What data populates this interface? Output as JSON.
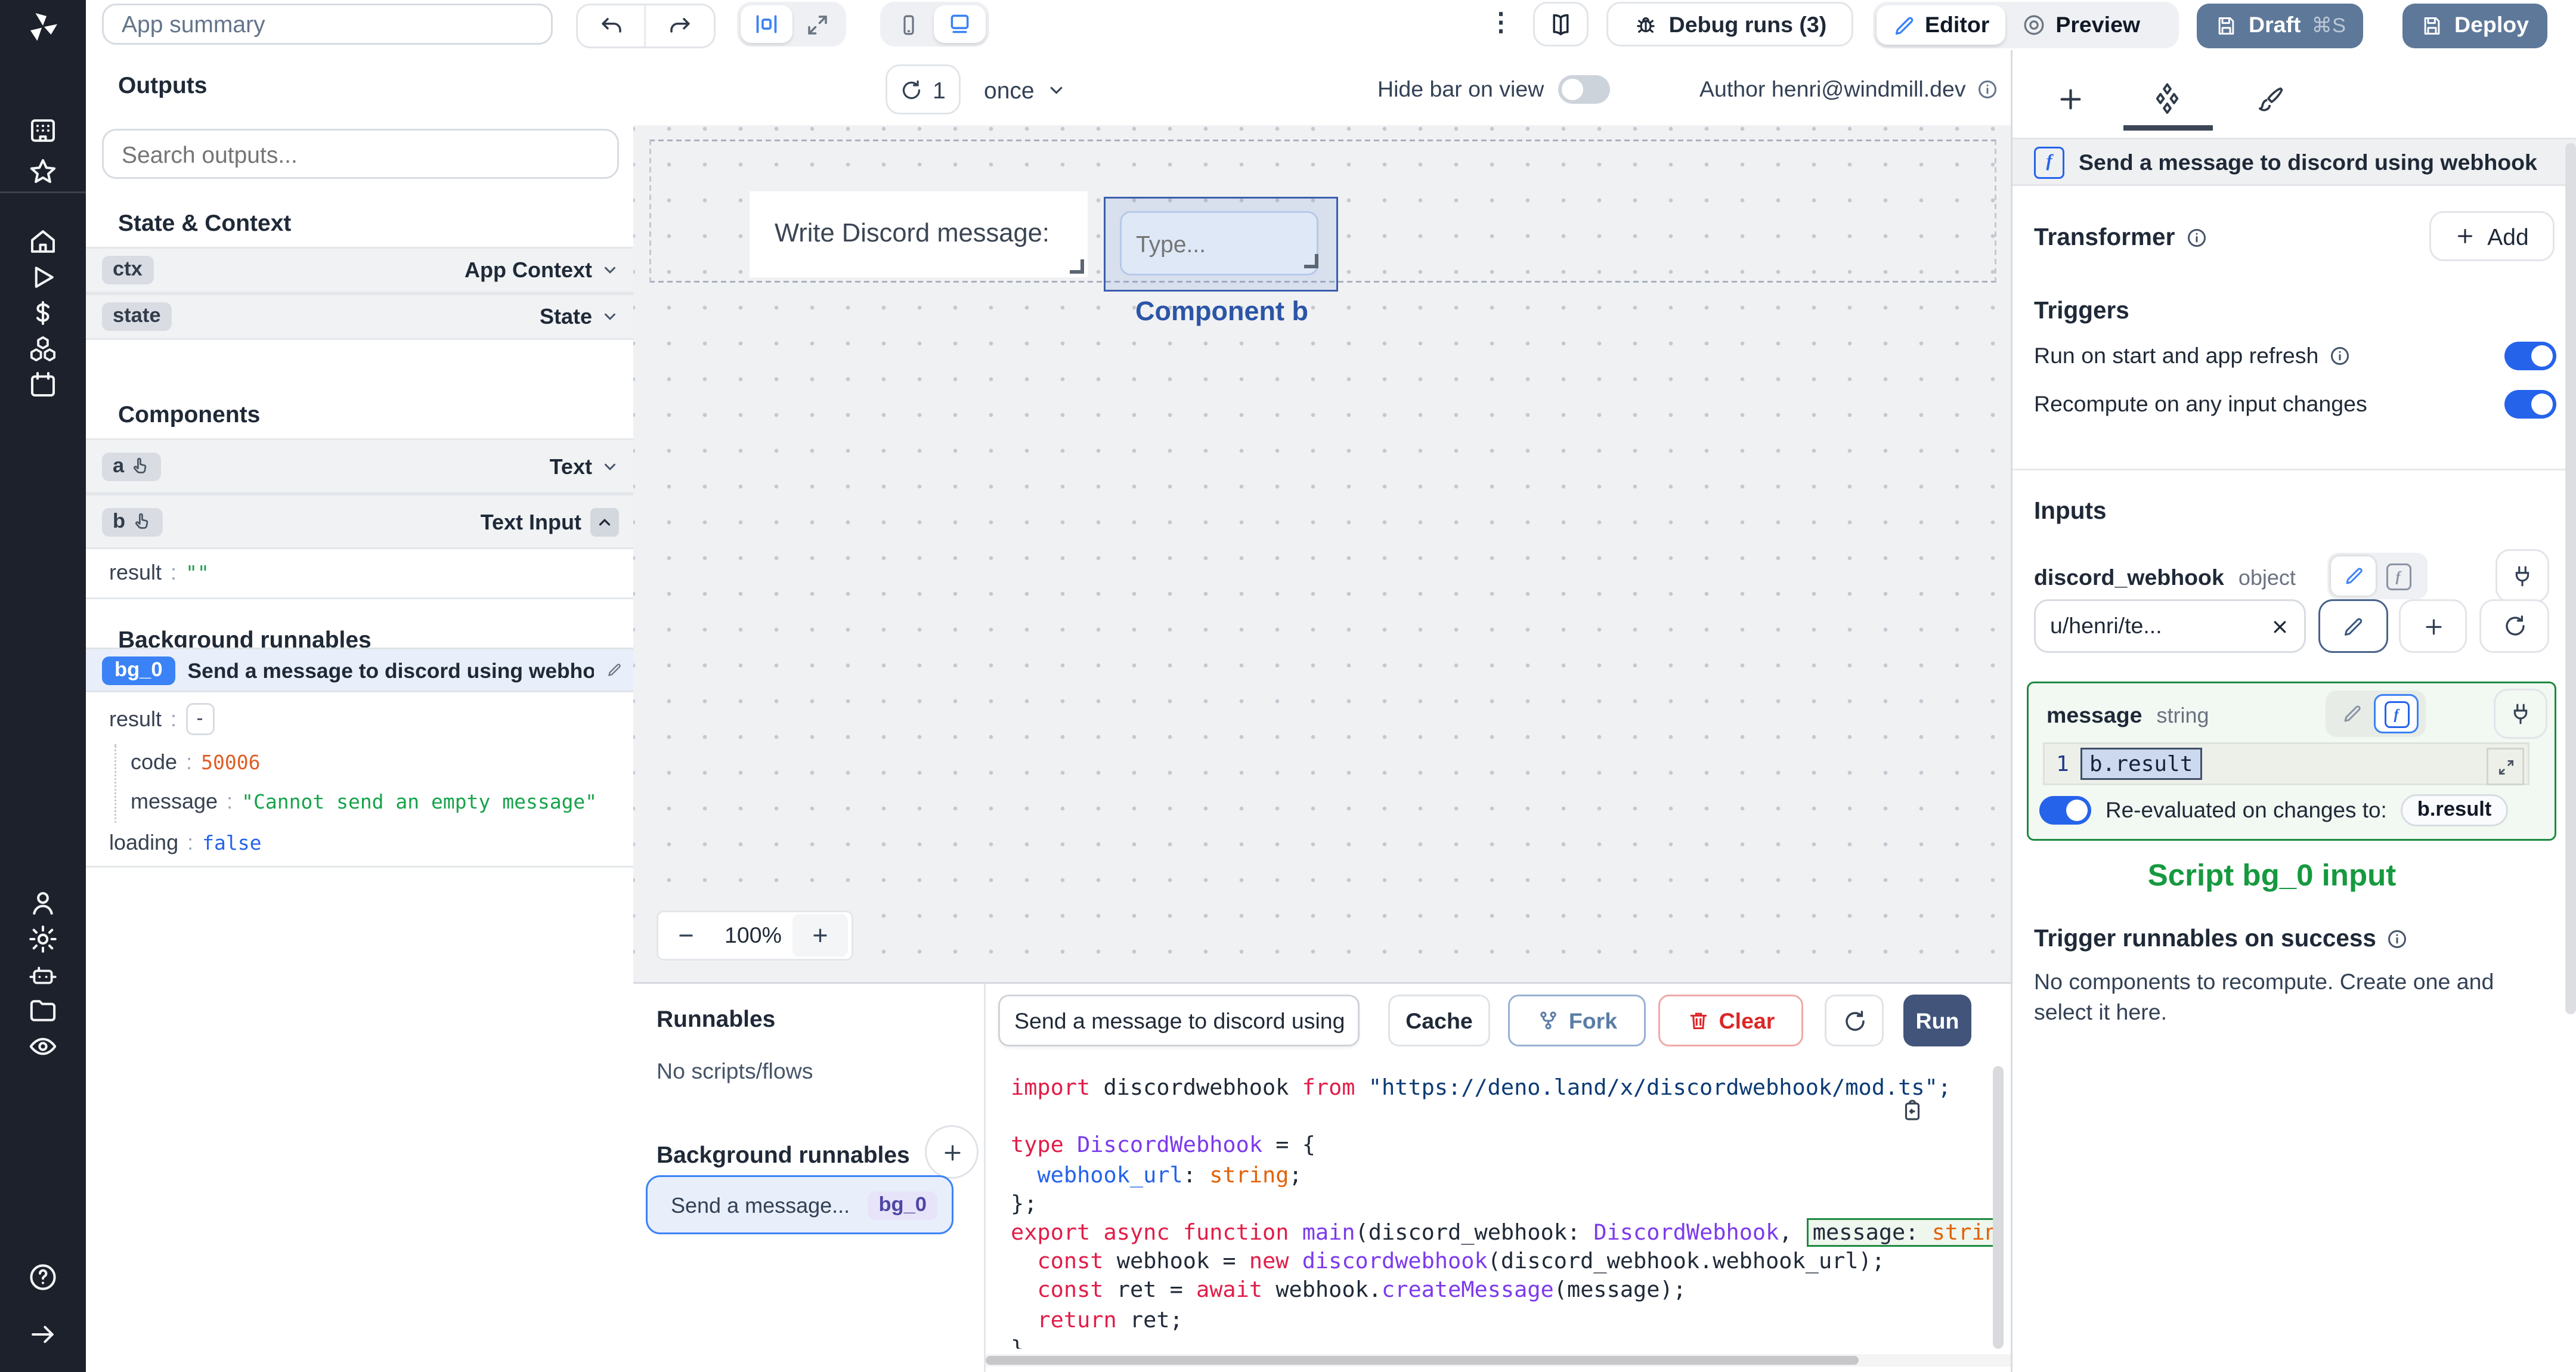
{
  "topbar": {
    "app_summary_value": "App summary",
    "debug_runs": "Debug runs (3)",
    "editor": "Editor",
    "preview": "Preview",
    "draft": "Draft",
    "draft_shortcut": "⌘S",
    "deploy": "Deploy",
    "kebab_glyph": "⋮"
  },
  "left_panel": {
    "outputs_title": "Outputs",
    "search_placeholder": "Search outputs...",
    "state_context_title": "State & Context",
    "context_rows": [
      {
        "id": "ctx",
        "type": "App Context"
      },
      {
        "id": "state",
        "type": "State"
      }
    ],
    "components_title": "Components",
    "component_rows": [
      {
        "id": "a",
        "type": "Text"
      },
      {
        "id": "b",
        "type": "Text Input"
      }
    ],
    "b_output": {
      "key": "result",
      "value": "\"\""
    },
    "background_title": "Background runnables",
    "bg_row": {
      "badge": "bg_0",
      "label": "Send a message to discord using webhook"
    },
    "bg_output": {
      "result_key": "result",
      "collapse": "-",
      "code_key": "code",
      "code_value": "50006",
      "message_key": "message",
      "message_value": "\"Cannot send an empty message\"",
      "loading_key": "loading",
      "loading_value": "false"
    }
  },
  "canvas": {
    "refresh_count": "1",
    "schedule": "once",
    "hide_bar": "Hide bar on view",
    "author": "Author henri@windmill.dev",
    "text_component": "Write Discord message:",
    "input_placeholder": "Type...",
    "component_label": "Component b",
    "zoom_minus": "−",
    "zoom_value": "100%",
    "zoom_plus": "+"
  },
  "runnables_panel": {
    "title": "Runnables",
    "empty": "No scripts/flows",
    "background_title": "Background runnables",
    "card_label": "Send a message...",
    "card_badge": "bg_0"
  },
  "code_panel": {
    "name_field": "Send a message to discord using",
    "cache": "Cache",
    "fork": "Fork",
    "clear": "Clear",
    "run": "Run",
    "lines": [
      [
        {
          "t": "import",
          "c": "kw"
        },
        {
          "t": " discordwebhook ",
          "c": "pl"
        },
        {
          "t": "from",
          "c": "kw"
        },
        {
          "t": " ",
          "c": "pl"
        },
        {
          "t": "\"https://deno.land/x/discordwebhook/mod.ts\";",
          "c": "str"
        }
      ],
      [],
      [
        {
          "t": "type",
          "c": "kw"
        },
        {
          "t": " ",
          "c": "pl"
        },
        {
          "t": "DiscordWebhook",
          "c": "fn"
        },
        {
          "t": " = {",
          "c": "pl"
        }
      ],
      [
        {
          "t": "  ",
          "c": "pl"
        },
        {
          "t": "webhook_url",
          "c": "var"
        },
        {
          "t": ": ",
          "c": "pl"
        },
        {
          "t": "string",
          "c": "or"
        },
        {
          "t": ";",
          "c": "pl"
        }
      ],
      [
        {
          "t": "};",
          "c": "pl"
        }
      ],
      [
        {
          "t": "export",
          "c": "kw"
        },
        {
          "t": " ",
          "c": "pl"
        },
        {
          "t": "async",
          "c": "kw"
        },
        {
          "t": " ",
          "c": "pl"
        },
        {
          "t": "function",
          "c": "kw"
        },
        {
          "t": " ",
          "c": "pl"
        },
        {
          "t": "main",
          "c": "fn"
        },
        {
          "t": "(discord_webhook: ",
          "c": "pl"
        },
        {
          "t": "DiscordWebhook",
          "c": "fn"
        },
        {
          "t": ", ",
          "c": "pl"
        },
        {
          "t": "message: ",
          "c": "pl",
          "h": true
        },
        {
          "t": "string",
          "c": "or",
          "h": true
        }
      ],
      [
        {
          "t": "  ",
          "c": "pl"
        },
        {
          "t": "const",
          "c": "kw"
        },
        {
          "t": " webhook = ",
          "c": "pl"
        },
        {
          "t": "new",
          "c": "kw"
        },
        {
          "t": " ",
          "c": "pl"
        },
        {
          "t": "discordwebhook",
          "c": "fn"
        },
        {
          "t": "(discord_webhook.webhook_url);",
          "c": "pl"
        }
      ],
      [
        {
          "t": "  ",
          "c": "pl"
        },
        {
          "t": "const",
          "c": "kw"
        },
        {
          "t": " ret = ",
          "c": "pl"
        },
        {
          "t": "await",
          "c": "kw"
        },
        {
          "t": " webhook.",
          "c": "pl"
        },
        {
          "t": "createMessage",
          "c": "fn"
        },
        {
          "t": "(message);",
          "c": "pl"
        }
      ],
      [
        {
          "t": "  ",
          "c": "pl"
        },
        {
          "t": "return",
          "c": "kw"
        },
        {
          "t": " ret;",
          "c": "pl"
        }
      ],
      [
        {
          "t": "}",
          "c": "pl"
        }
      ]
    ]
  },
  "right_panel": {
    "header": "Send a message to discord using webhook",
    "transformer": "Transformer",
    "add": "Add",
    "triggers_title": "Triggers",
    "trigger_rows": [
      {
        "label": "Run on start and app refresh"
      },
      {
        "label": "Recompute on any input changes"
      }
    ],
    "inputs_title": "Inputs",
    "discord_webhook": {
      "name": "discord_webhook",
      "type": "object",
      "value": "u/henri/te..."
    },
    "message": {
      "name": "message",
      "type": "string",
      "line_number": "1",
      "expression": "b.result",
      "reeval_label": "Re-evaluated on changes to:",
      "reeval_chip": "b.result"
    },
    "script_input_label": "Script bg_0 input",
    "success_title": "Trigger runnables on success",
    "success_text": "No components to recompute. Create one and select it here."
  },
  "colors": {
    "accent_blue": "#3b82f6",
    "toggle_on": "#2563eb",
    "slate_button": "#5e7899",
    "run_button": "#42547a",
    "green_highlight_border": "#1d8a41",
    "script_label_green": "#16993f",
    "component_selection_blue": "#3b5fae",
    "code_keyword_red": "#e11d48",
    "code_purple": "#7c3aed",
    "code_orange": "#e36209",
    "code_blue": "#2563eb",
    "code_string_navy": "#0c3b76",
    "value_orange": "#e05d26",
    "value_green": "#16a34a",
    "value_blue": "#2563eb"
  }
}
